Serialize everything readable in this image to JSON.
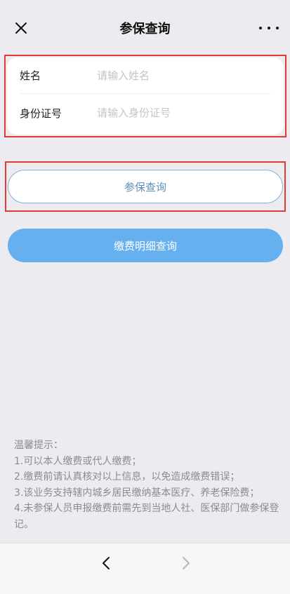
{
  "header": {
    "title": "参保查询",
    "close_icon": "close-icon",
    "more_icon": "more-icon"
  },
  "form": {
    "fields": [
      {
        "label": "姓名",
        "placeholder": "请输入姓名",
        "value": ""
      },
      {
        "label": "身份证号",
        "placeholder": "请输入身份证号",
        "value": ""
      }
    ]
  },
  "buttons": {
    "query_label": "参保查询",
    "detail_label": "缴费明细查询"
  },
  "notes": {
    "title": "温馨提示：",
    "items": [
      "1.可以本人缴费或代人缴费；",
      "2.缴费前请认真核对以上信息，以免造成缴费错误；",
      "3.该业务支持辖内城乡居民缴纳基本医疗、养老保险费；",
      "4.未参保人员申报缴费前需先到当地人社、医保部门做参保登记。"
    ]
  },
  "nav": {
    "back_icon": "chevron-left-icon",
    "forward_icon": "chevron-right-icon"
  },
  "colors": {
    "highlight": "#e53935",
    "primary": "#66b0f0",
    "outline_button_text": "#5a8fc1"
  }
}
